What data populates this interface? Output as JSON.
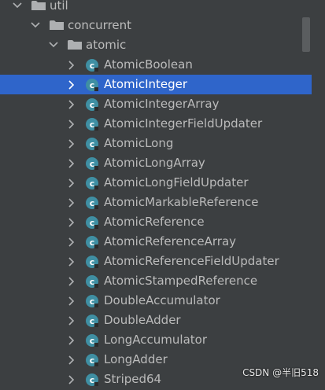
{
  "tree": {
    "folders": [
      {
        "label": "util",
        "expanded": true
      },
      {
        "label": "concurrent",
        "expanded": true
      },
      {
        "label": "atomic",
        "expanded": true
      }
    ],
    "classes": [
      {
        "label": "AtomicBoolean",
        "selected": false
      },
      {
        "label": "AtomicInteger",
        "selected": true
      },
      {
        "label": "AtomicIntegerArray",
        "selected": false
      },
      {
        "label": "AtomicIntegerFieldUpdater",
        "selected": false
      },
      {
        "label": "AtomicLong",
        "selected": false
      },
      {
        "label": "AtomicLongArray",
        "selected": false
      },
      {
        "label": "AtomicLongFieldUpdater",
        "selected": false
      },
      {
        "label": "AtomicMarkableReference",
        "selected": false
      },
      {
        "label": "AtomicReference",
        "selected": false
      },
      {
        "label": "AtomicReferenceArray",
        "selected": false
      },
      {
        "label": "AtomicReferenceFieldUpdater",
        "selected": false
      },
      {
        "label": "AtomicStampedReference",
        "selected": false
      },
      {
        "label": "DoubleAccumulator",
        "selected": false
      },
      {
        "label": "DoubleAdder",
        "selected": false
      },
      {
        "label": "LongAccumulator",
        "selected": false
      },
      {
        "label": "LongAdder",
        "selected": false
      },
      {
        "label": "Striped64",
        "selected": false
      }
    ]
  },
  "icons": {
    "folder": "folder-icon",
    "class": "java-class-icon",
    "expand": "chevron-right-icon",
    "collapse": "chevron-down-icon"
  },
  "colors": {
    "background": "#3c3f41",
    "selection": "#2f65ca",
    "class_icon": "#3f8fa3",
    "text": "#bbbbbb"
  },
  "watermark": "CSDN @半旧518"
}
